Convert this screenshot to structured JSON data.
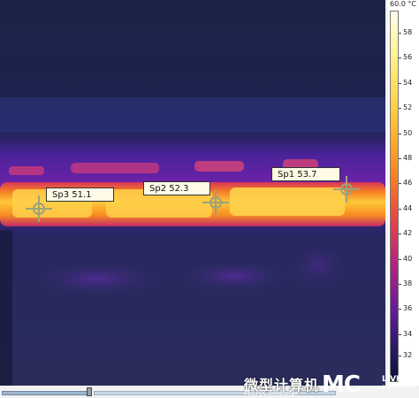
{
  "spots": [
    {
      "name": "Sp1",
      "value": "53.7"
    },
    {
      "name": "Sp2",
      "value": "52.3"
    },
    {
      "name": "Sp3",
      "value": "51.1"
    }
  ],
  "scale": {
    "max_label": "60.0 °C",
    "ticks": [
      "58",
      "56",
      "54",
      "52",
      "50",
      "48",
      "46",
      "44",
      "42",
      "40",
      "38",
      "36",
      "34",
      "32"
    ]
  },
  "watermark": {
    "chinese": "微型计算机",
    "english": "MicroComputer",
    "logo": "MC",
    "live": "LIVE",
    "professional": "professional"
  },
  "colors": {
    "background": "#1d2148",
    "hot": "#ffc93a",
    "warm": "#ea4a3e",
    "mid": "#6a1a9c"
  }
}
